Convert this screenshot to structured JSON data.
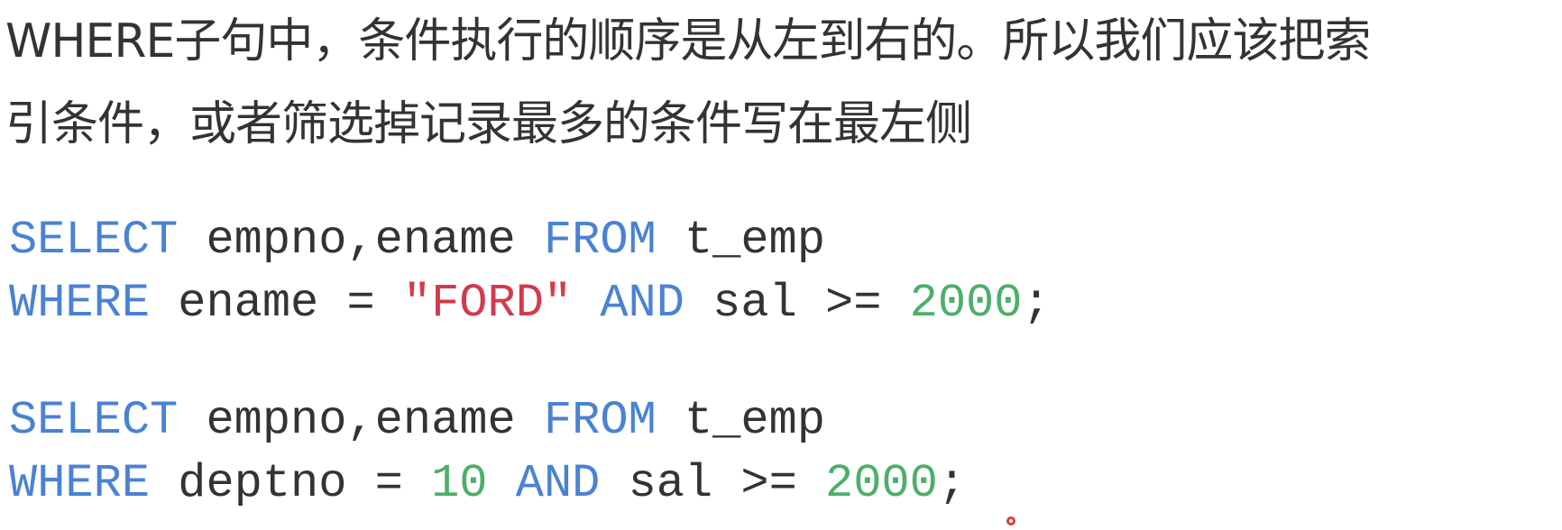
{
  "paragraph": {
    "line1": "WHERE子句中，条件执行的顺序是从左到右的。所以我们应该把索",
    "line2": "引条件，或者筛选掉记录最多的条件写在最左侧"
  },
  "code_blocks": [
    {
      "line1": {
        "kw1": "SELECT",
        "cols": " empno,ename ",
        "kw2": "FROM",
        "table": " t_emp"
      },
      "line2": {
        "kw1": "WHERE",
        "col": " ename = ",
        "str": "\"FORD\"",
        "sp": " ",
        "kw2": "AND",
        "cond": " sal >= ",
        "num": "2000",
        "end": ";"
      }
    },
    {
      "line1": {
        "kw1": "SELECT",
        "cols": " empno,ename ",
        "kw2": "FROM",
        "table": " t_emp"
      },
      "line2": {
        "kw1": "WHERE",
        "col": " deptno = ",
        "num1": "10",
        "sp": " ",
        "kw2": "AND",
        "cond": " sal >= ",
        "num2": "2000",
        "end": ";"
      }
    }
  ],
  "colors": {
    "keyword": "#4a82d4",
    "string": "#d23a4e",
    "number": "#4caf6a",
    "text": "#333333",
    "cursor": "#e03a3a"
  }
}
